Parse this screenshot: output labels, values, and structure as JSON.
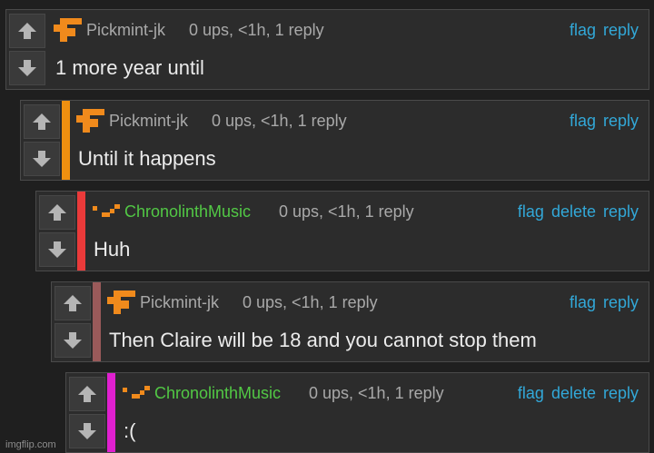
{
  "comments": [
    {
      "username": "Pickmint-jk",
      "meta": "0 ups, <1h, 1 reply",
      "text": "1 more year until",
      "actions": [
        "flag",
        "reply"
      ],
      "username_color": "#a9a9a9",
      "thread_bar_color": null,
      "avatar": "orange-pixel-logo-large"
    },
    {
      "username": "Pickmint-jk",
      "meta": "0 ups, <1h, 1 reply",
      "text": "Until it happens",
      "actions": [
        "flag",
        "reply"
      ],
      "username_color": "#a9a9a9",
      "thread_bar_color": "#f09010",
      "avatar": "orange-pixel-logo-large"
    },
    {
      "username": "ChronolinthMusic",
      "meta": "0 ups, <1h, 1 reply",
      "text": "Huh",
      "actions": [
        "flag",
        "delete",
        "reply"
      ],
      "username_color": "#52c845",
      "thread_bar_color": "#ea3a3a",
      "avatar": "orange-pixel-logo-small"
    },
    {
      "username": "Pickmint-jk",
      "meta": "0 ups, <1h, 1 reply",
      "text": "Then Claire will be 18 and you cannot stop them",
      "actions": [
        "flag",
        "reply"
      ],
      "username_color": "#a9a9a9",
      "thread_bar_color": "#9a5a5a",
      "avatar": "orange-pixel-logo-large"
    },
    {
      "username": "ChronolinthMusic",
      "meta": "0 ups, <1h, 1 reply",
      "text": ":(",
      "actions": [
        "flag",
        "delete",
        "reply"
      ],
      "username_color": "#52c845",
      "thread_bar_color": "#e020d0",
      "avatar": "orange-pixel-logo-small"
    }
  ],
  "watermark": "imgflip.com",
  "colors": {
    "background": "#1f1f1f",
    "card": "#2c2c2c",
    "link": "#32a8d8",
    "avatar_orange": "#f08a1c"
  }
}
